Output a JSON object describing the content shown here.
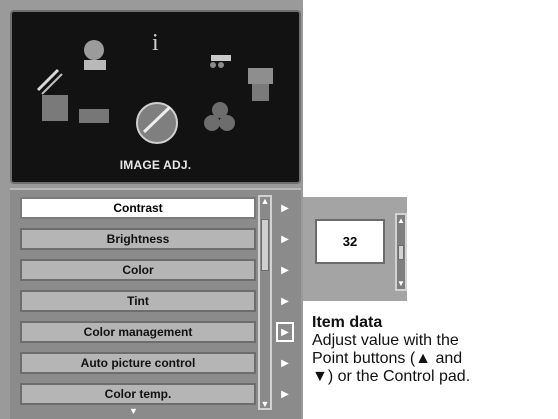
{
  "top_title": "IMAGE ADJ.",
  "menu": {
    "items": [
      {
        "label": "Contrast",
        "selected": true
      },
      {
        "label": "Brightness"
      },
      {
        "label": "Color"
      },
      {
        "label": "Tint"
      },
      {
        "label": "Color management",
        "outlined_arrow": true
      },
      {
        "label": "Auto picture control"
      },
      {
        "label": "Color temp."
      }
    ],
    "arrow_glyph": "▶",
    "scroll_up": "▲",
    "scroll_down": "▼",
    "bottom_chevron": "▼"
  },
  "item_data": {
    "value": "32",
    "title": "Item data",
    "description_lines": [
      "Adjust value with the",
      "Point buttons (▲ and",
      "▼) or the Control pad."
    ]
  },
  "icons": {
    "top_icons": [
      "pencil-icon",
      "person-icon",
      "info-icon",
      "projector-icon",
      "folder-icon",
      "ruler-icon",
      "image-adjust-icon",
      "balls-icon",
      "screen-icon"
    ]
  }
}
